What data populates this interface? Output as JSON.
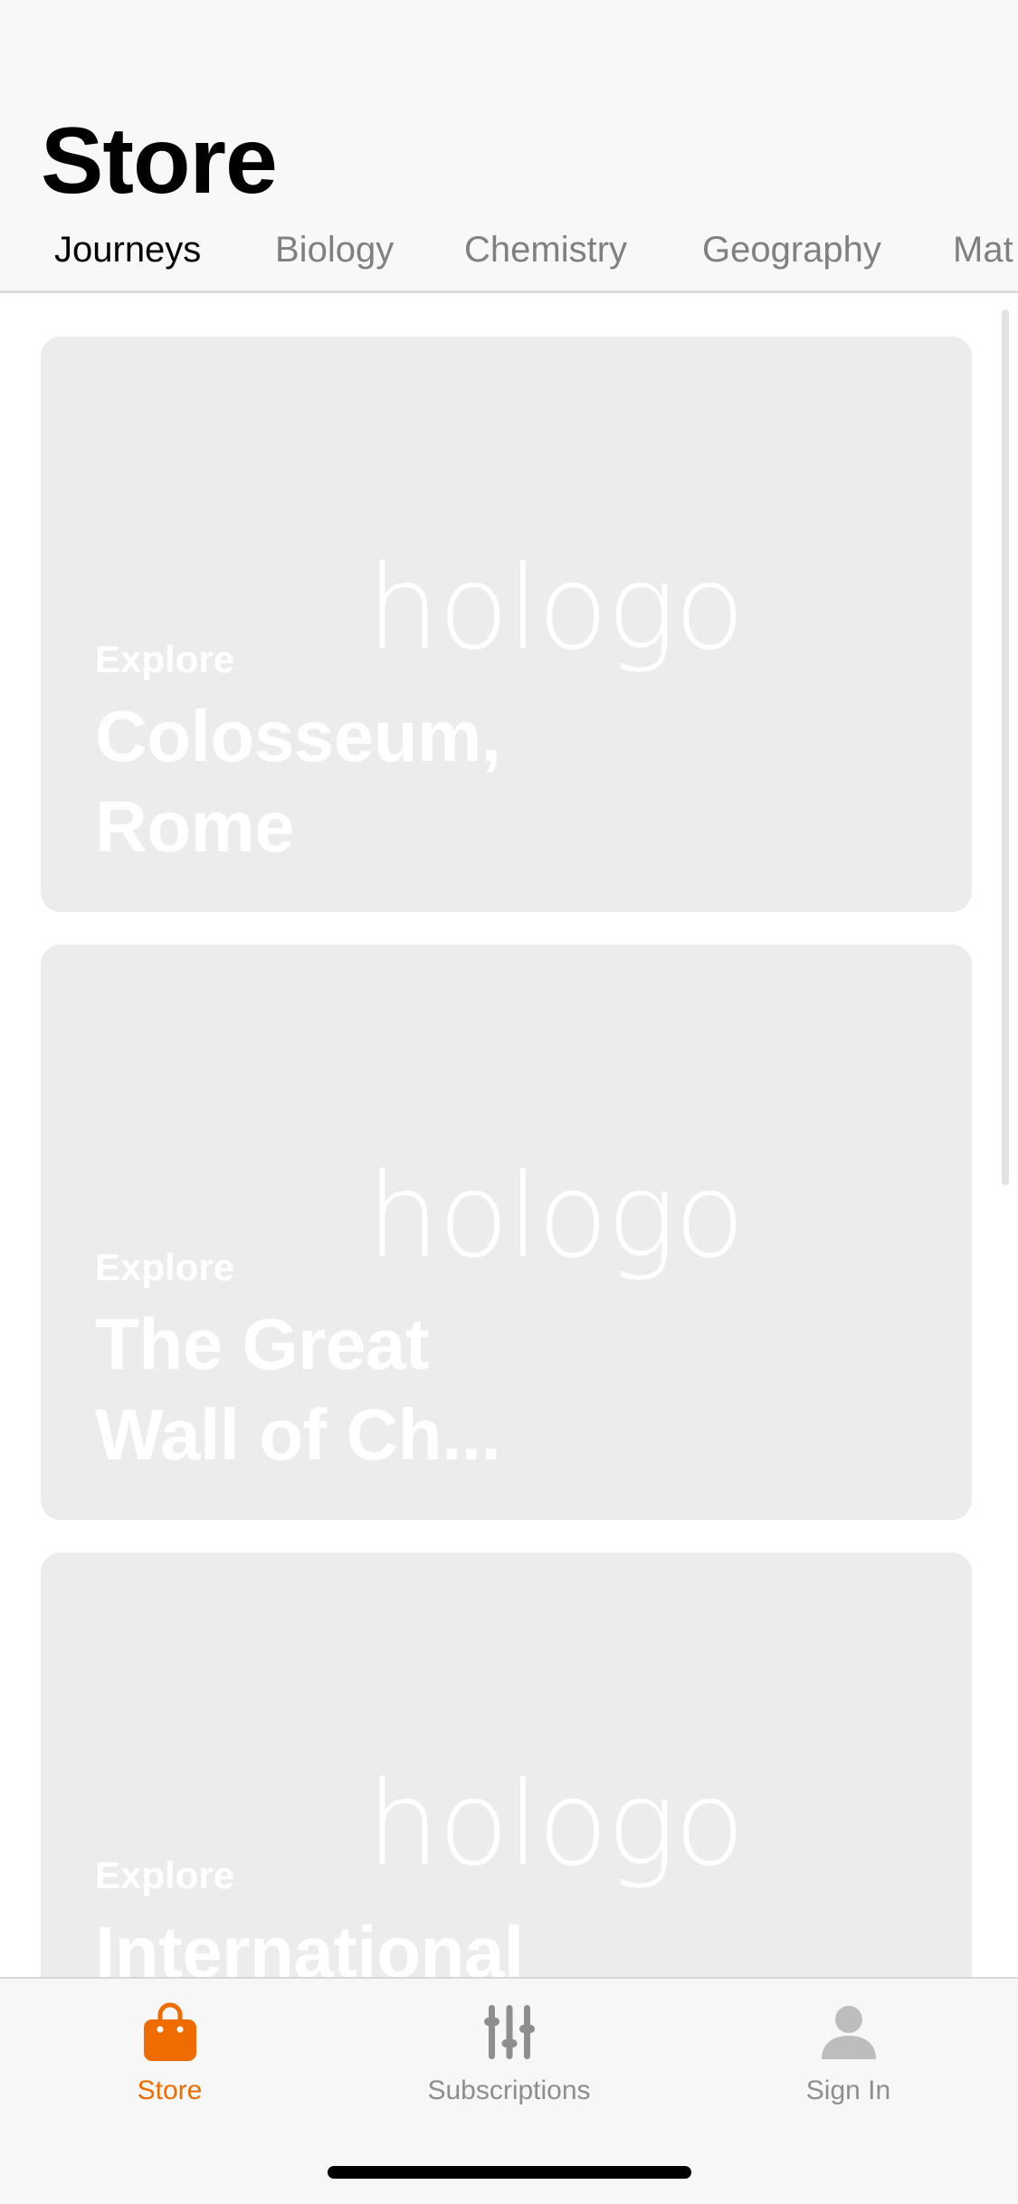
{
  "header": {
    "title": "Store",
    "tabs": [
      {
        "label": "Journeys",
        "active": true
      },
      {
        "label": "Biology",
        "active": false
      },
      {
        "label": "Chemistry",
        "active": false
      },
      {
        "label": "Geography",
        "active": false
      },
      {
        "label": "Mat",
        "active": false
      }
    ]
  },
  "cards": [
    {
      "logo_text": "hologo",
      "eyebrow": "Explore",
      "title_lines": [
        "Colosseum,",
        "Rome"
      ]
    },
    {
      "logo_text": "hologo",
      "eyebrow": "Explore",
      "title_lines": [
        "The Great",
        "Wall of Ch..."
      ]
    },
    {
      "logo_text": "hologo",
      "eyebrow": "Explore",
      "title_lines": [
        "International",
        ""
      ]
    }
  ],
  "tabbar": {
    "items": [
      {
        "label": "Store",
        "icon": "shopping-bag-icon",
        "active": true
      },
      {
        "label": "Subscriptions",
        "icon": "sliders-icon",
        "active": false
      },
      {
        "label": "Sign In",
        "icon": "person-icon",
        "active": false
      }
    ]
  },
  "colors": {
    "accent": "#ef6c00",
    "card_background": "#ececec",
    "inactive": "#8e8e8e",
    "header_background": "#f8f8f8"
  }
}
